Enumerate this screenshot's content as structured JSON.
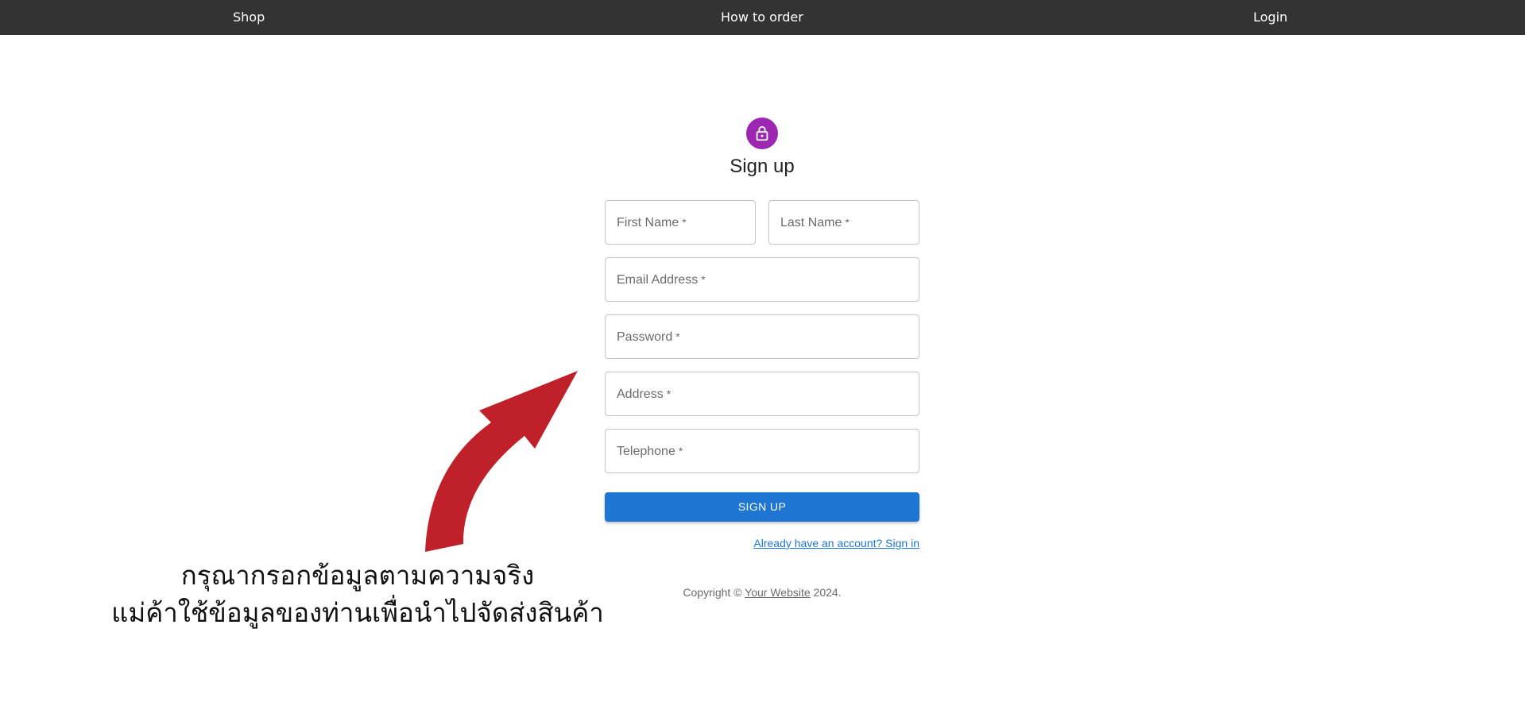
{
  "nav": {
    "shop": "Shop",
    "how_to_order": "How to order",
    "login": "Login"
  },
  "form": {
    "title": "Sign up",
    "icon": "lock-icon",
    "accent_color": "#9c27b0",
    "fields": {
      "first_name": "First Name",
      "last_name": "Last Name",
      "email": "Email Address",
      "password": "Password",
      "address": "Address",
      "telephone": "Telephone"
    },
    "required_mark": "*",
    "submit_label": "SIGN UP",
    "submit_color": "#1e76d2",
    "signin_link": "Already have an account? Sign in"
  },
  "footer": {
    "prefix": "Copyright © ",
    "link": "Your Website",
    "suffix": " 2024."
  },
  "annotation": {
    "line1": "กรุณากรอกข้อมูลตามความจริง",
    "line2": "แม่ค้าใช้ข้อมูลของท่านเพื่อนำไปจัดส่งสินค้า",
    "arrow_color": "#c0202a"
  }
}
